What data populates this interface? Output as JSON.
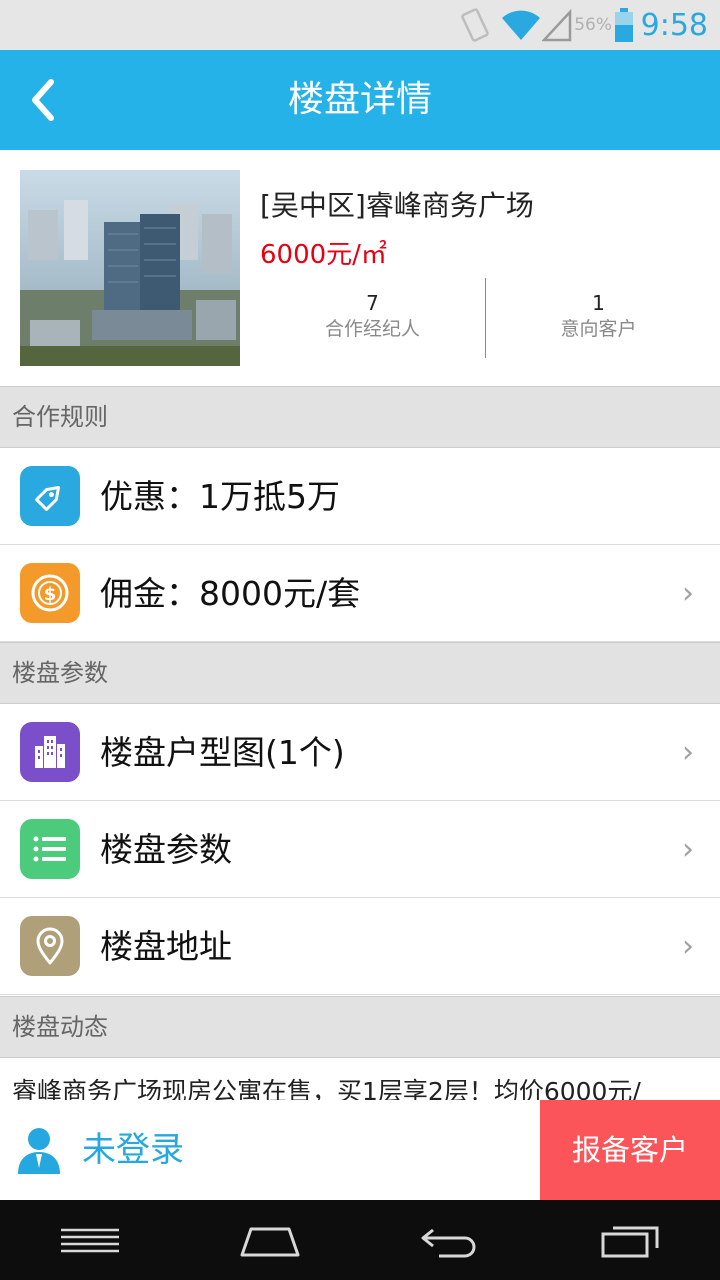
{
  "status_bar": {
    "time": "9:58",
    "battery_percent": "56%"
  },
  "header": {
    "title": "楼盘详情"
  },
  "project": {
    "name": "[吴中区]睿峰商务广场",
    "price": "6000元/㎡",
    "stats": [
      {
        "value": "7",
        "label": "合作经纪人"
      },
      {
        "value": "1",
        "label": "意向客户"
      }
    ]
  },
  "sections": {
    "rules": "合作规则",
    "params": "楼盘参数",
    "news": "楼盘动态"
  },
  "rules_items": [
    {
      "label": "优惠：1万抵5万",
      "icon": "tag-icon",
      "color": "#29a9e0"
    },
    {
      "label": "佣金：8000元/套",
      "icon": "dollar-coin-icon",
      "color": "#f49a2b"
    }
  ],
  "param_items": [
    {
      "label": "楼盘户型图(1个)",
      "icon": "building-icon",
      "color": "#7a4fc9"
    },
    {
      "label": "楼盘参数",
      "icon": "list-icon",
      "color": "#4ccb7c"
    },
    {
      "label": "楼盘地址",
      "icon": "location-pin-icon",
      "color": "#b0a079"
    }
  ],
  "chevron": "›",
  "news_text": "睿峰商务广场现房公寓在售，买1层享2层！均价6000元/",
  "bottom_bar": {
    "login_text": "未登录",
    "report_button": "报备客户"
  },
  "colors": {
    "header_bg": "#25b2e9",
    "accent_red": "#e60012",
    "report_bg": "#fb5459"
  }
}
